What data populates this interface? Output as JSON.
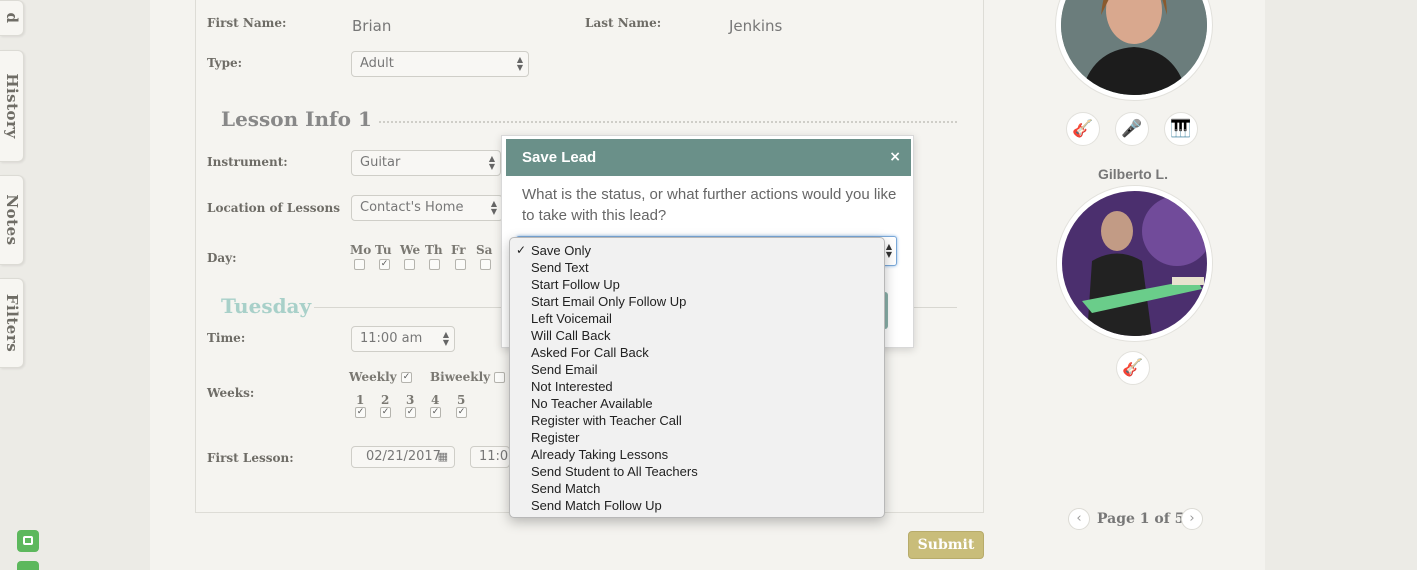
{
  "left_tabs": [
    {
      "label": "d"
    },
    {
      "label": "History"
    },
    {
      "label": "Notes"
    },
    {
      "label": "Filters"
    }
  ],
  "form": {
    "first_name_label": "First Name:",
    "first_name_value": "Brian",
    "last_name_label": "Last Name:",
    "last_name_value": "Jenkins",
    "type_label": "Type:",
    "type_value": "Adult",
    "lesson_section_title": "Lesson Info 1",
    "instrument_label": "Instrument:",
    "instrument_value": "Guitar",
    "location_label": "Location of Lessons",
    "location_value": "Contact's Home",
    "day_label": "Day:",
    "days": [
      {
        "label": "Mo",
        "checked": false
      },
      {
        "label": "Tu",
        "checked": true
      },
      {
        "label": "We",
        "checked": false
      },
      {
        "label": "Th",
        "checked": false
      },
      {
        "label": "Fr",
        "checked": false
      },
      {
        "label": "Sa",
        "checked": false
      }
    ],
    "day_section_title": "Tuesday",
    "time_label": "Time:",
    "time_value": "11:00 am",
    "weeks_label": "Weeks:",
    "weekly_label": "Weekly",
    "weekly_checked": true,
    "biweekly_label": "Biweekly",
    "biweekly_checked": false,
    "week_numbers": [
      {
        "label": "1",
        "checked": true
      },
      {
        "label": "2",
        "checked": true
      },
      {
        "label": "3",
        "checked": true
      },
      {
        "label": "4",
        "checked": true
      },
      {
        "label": "5",
        "checked": true
      }
    ],
    "first_lesson_label": "First Lesson:",
    "first_lesson_date": "02/21/2017",
    "first_lesson_time": "11:00 a",
    "submit_label": "Submit"
  },
  "teachers": {
    "teacher2_name": "Gilberto L.",
    "pagination": "Page 1 of 5"
  },
  "modal": {
    "title": "Save Lead",
    "close": "×",
    "question": "What is the status, or what further actions would you like to take with this lead?"
  },
  "dropdown": {
    "selected": "Save Only",
    "options": [
      "Save Only",
      "Send Text",
      "Start Follow Up",
      "Start Email Only Follow Up",
      "Left Voicemail",
      "Will Call Back",
      "Asked For Call Back",
      "Send Email",
      "Not Interested",
      "No Teacher Available",
      "Register with Teacher Call",
      "Register",
      "Already Taking Lessons",
      "Send Student to All Teachers",
      "Send Match",
      "Send Match Follow Up"
    ]
  },
  "colors": {
    "modal_header": "#6a9089",
    "submit": "#c9bd7a",
    "section_day": "#9cc8c0",
    "side_badge": "#5db85d"
  }
}
